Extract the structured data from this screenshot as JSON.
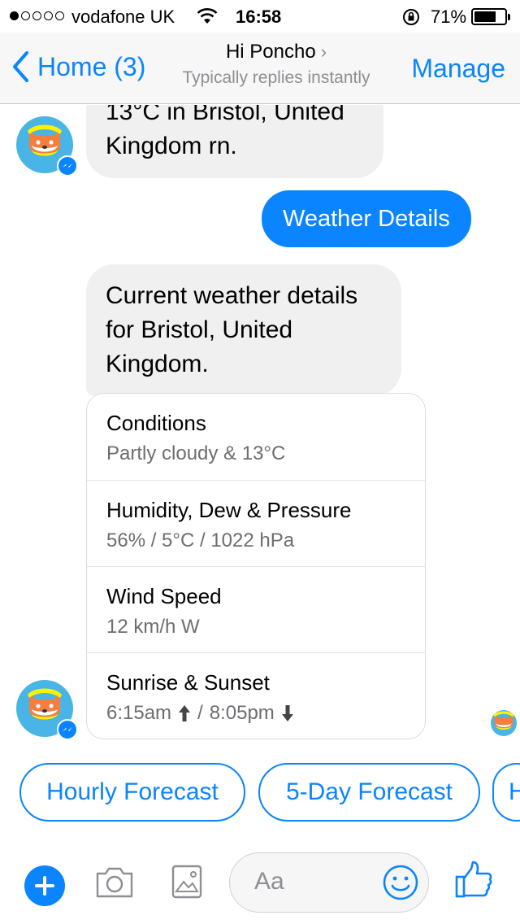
{
  "status_bar": {
    "carrier": "vodafone UK",
    "time": "16:58",
    "battery_percent": "71%",
    "battery_level": 0.71,
    "signal_bars_filled": 1,
    "signal_bars_total": 5
  },
  "nav": {
    "back_label": "Home (3)",
    "title": "Hi Poncho",
    "subtitle": "Typically replies instantly",
    "right_button": "Manage"
  },
  "messages": [
    {
      "from": "bot",
      "text": "13°C in Bristol, United Kingdom rn."
    },
    {
      "from": "user",
      "text": "Weather Details"
    },
    {
      "from": "bot",
      "text": "Current weather details for Bristol, United Kingdom."
    }
  ],
  "details": [
    {
      "title": "Conditions",
      "subtitle": "Partly cloudy & 13°C"
    },
    {
      "title": "Humidity, Dew & Pressure",
      "subtitle": "56% / 5°C / 1022 hPa"
    },
    {
      "title": "Wind Speed",
      "subtitle": "12 km/h W"
    },
    {
      "title": "Sunrise & Sunset",
      "sunrise": "6:15am",
      "separator": "/",
      "sunset": "8:05pm"
    }
  ],
  "quick_replies": [
    "Hourly Forecast",
    "5-Day Forecast",
    "H"
  ],
  "composer": {
    "placeholder": "Aa"
  },
  "colors": {
    "accent": "#0a84ff",
    "bubble_in": "#f1f0f0",
    "avatar_bg": "#49b5e6",
    "cat_orange": "#f47e3e"
  }
}
